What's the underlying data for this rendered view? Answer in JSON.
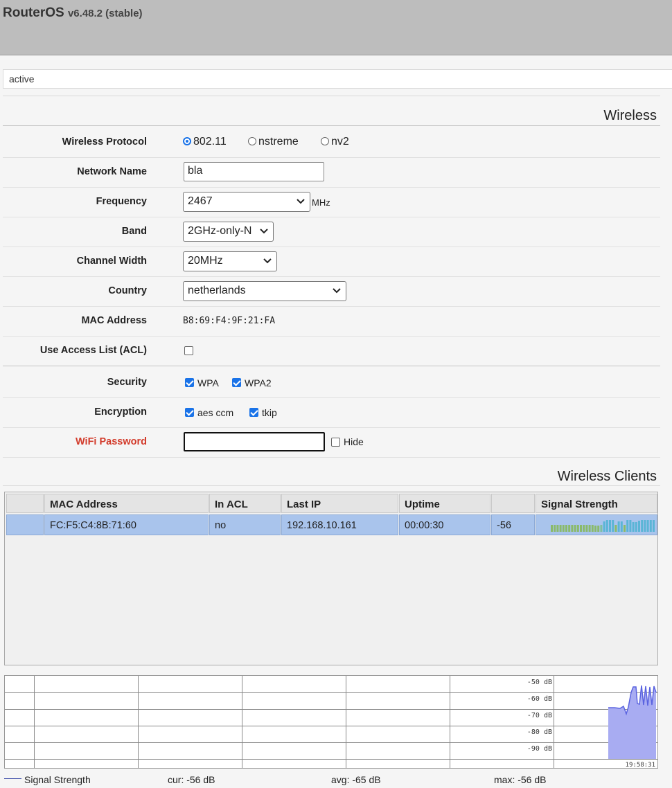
{
  "header": {
    "brand": "RouterOS",
    "version": "v6.48.2 (stable)"
  },
  "status": "active",
  "wireless": {
    "title": "Wireless",
    "protocol_label": "Wireless Protocol",
    "protocols": [
      "802.11",
      "nstreme",
      "nv2"
    ],
    "protocol_selected": "802.11",
    "network_name_label": "Network Name",
    "network_name": "bla",
    "frequency_label": "Frequency",
    "frequency": "2467",
    "frequency_unit": "MHz",
    "band_label": "Band",
    "band": "2GHz-only-N",
    "channel_width_label": "Channel Width",
    "channel_width": "20MHz",
    "country_label": "Country",
    "country": "netherlands",
    "mac_label": "MAC Address",
    "mac": "B8:69:F4:9F:21:FA",
    "acl_label": "Use Access List (ACL)",
    "acl_checked": false,
    "security_label": "Security",
    "security": [
      {
        "label": "WPA",
        "checked": true
      },
      {
        "label": "WPA2",
        "checked": true
      }
    ],
    "encryption_label": "Encryption",
    "encryption": [
      {
        "label": "aes ccm",
        "checked": true
      },
      {
        "label": "tkip",
        "checked": true
      }
    ],
    "password_label": "WiFi Password",
    "password": "",
    "hide_label": "Hide",
    "hide_checked": false
  },
  "clients": {
    "title": "Wireless Clients",
    "columns": [
      "",
      "MAC Address",
      "In ACL",
      "Last IP",
      "Uptime",
      "",
      "Signal Strength"
    ],
    "rows": [
      {
        "mac": "FC:F5:C4:8B:71:60",
        "in_acl": "no",
        "last_ip": "192.168.10.161",
        "uptime": "00:00:30",
        "signal": "-56"
      }
    ]
  },
  "graph": {
    "y_labels": [
      "-50 dB",
      "-60 dB",
      "-70 dB",
      "-80 dB",
      "-90 dB"
    ],
    "time_label": "19:58:31",
    "legend_label": "Signal Strength",
    "cur": "cur: -56 dB",
    "avg": "avg: -65 dB",
    "max": "max: -56 dB",
    "colors": {
      "fill": "#a8acf2",
      "line": "#5a63e0"
    }
  }
}
